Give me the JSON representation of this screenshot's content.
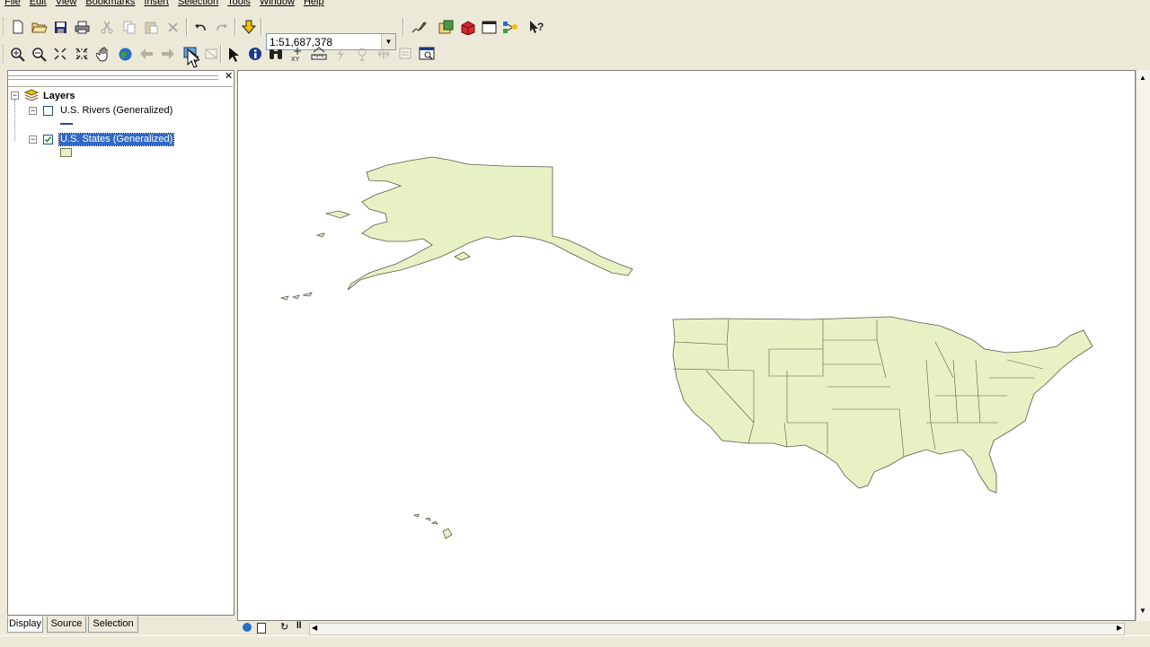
{
  "menu": [
    "File",
    "Edit",
    "View",
    "Bookmarks",
    "Insert",
    "Selection",
    "Tools",
    "Window",
    "Help"
  ],
  "toolbar": {
    "scale_value": "1:51,687,378",
    "standard_icons": [
      "new-document-icon",
      "open-folder-icon",
      "save-icon",
      "print-icon",
      "cut-icon",
      "copy-icon",
      "paste-icon",
      "delete-icon",
      "undo-icon",
      "redo-icon",
      "add-data-icon"
    ],
    "right_icons": [
      "editor-toolbar-icon",
      "arccatalog-icon",
      "arctoolbox-icon",
      "command-line-icon",
      "modelbuilder-icon",
      "whats-this-icon"
    ],
    "tools_icons": [
      "zoom-in-icon",
      "zoom-out-icon",
      "fixed-zoom-in-icon",
      "fixed-zoom-out-icon",
      "pan-icon",
      "full-extent-icon",
      "back-extent-icon",
      "forward-extent-icon",
      "select-features-icon",
      "clear-selection-icon",
      "select-elements-icon",
      "identify-icon",
      "find-icon",
      "go-to-xy-icon",
      "measure-icon",
      "hyperlink-icon",
      "html-popup-icon",
      "swipe-icon",
      "time-slider-icon",
      "create-viewer-window-icon"
    ]
  },
  "toc": {
    "root_label": "Layers",
    "layers": [
      {
        "name": "U.S. Rivers (Generalized)",
        "checked": false,
        "selected": false,
        "symbol": "line"
      },
      {
        "name": "U.S. States (Generalized)",
        "checked": true,
        "selected": true,
        "symbol": "polygon"
      }
    ],
    "tabs": [
      "Display",
      "Source",
      "Selection"
    ]
  },
  "colors": {
    "state_fill": "#e8f1c4",
    "state_outline": "#5a5a4a",
    "river_line": "#1f4e99",
    "selection": "#316ac5"
  }
}
